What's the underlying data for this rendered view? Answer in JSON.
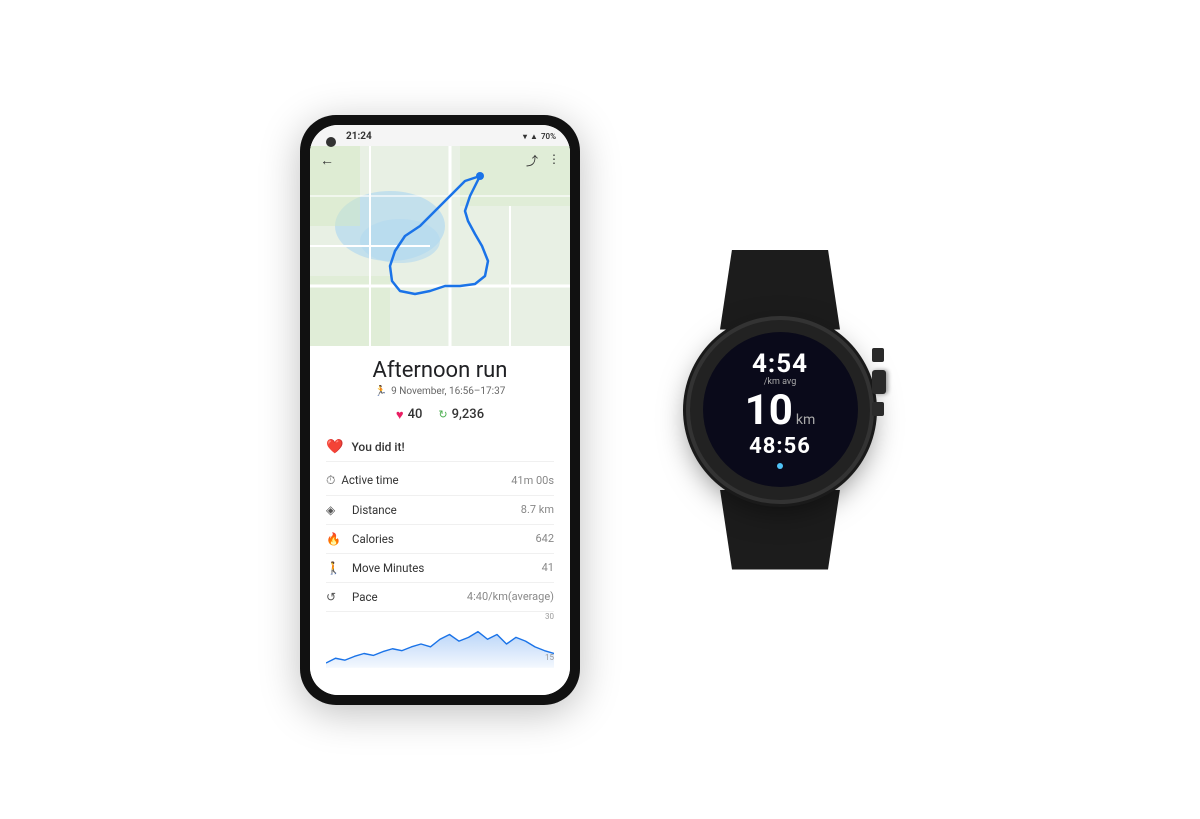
{
  "phone": {
    "status_bar": {
      "time": "21:24",
      "battery": "70%",
      "signal_icon": "▲",
      "wifi_icon": "▼",
      "battery_icon": "▮"
    },
    "toolbar": {
      "back_label": "←",
      "share_label": "⤴",
      "more_label": "⋮"
    },
    "activity": {
      "title": "Afternoon run",
      "date_icon": "🚶",
      "date": "9 November, 16:56–17:37",
      "heart_count": "40",
      "steps_count": "9,236"
    },
    "goal": {
      "icon": "❤",
      "text": "You did it!"
    },
    "active_time": {
      "icon": "⏱",
      "label": "Active time",
      "value": "41m 00s"
    },
    "metrics": [
      {
        "icon": "◈",
        "label": "Distance",
        "value": "8.7 km"
      },
      {
        "icon": "🔥",
        "label": "Calories",
        "value": "642"
      },
      {
        "icon": "🚶",
        "label": "Move Minutes",
        "value": "41"
      },
      {
        "icon": "⟳",
        "label": "Pace",
        "value": "4:40/km(average)"
      }
    ],
    "chart": {
      "label_top": "30",
      "label_bottom": "15"
    }
  },
  "watch": {
    "pace_time": "4:54",
    "pace_label": "/km avg",
    "distance": "10",
    "distance_unit": "km",
    "elapsed_time": "48:56"
  }
}
